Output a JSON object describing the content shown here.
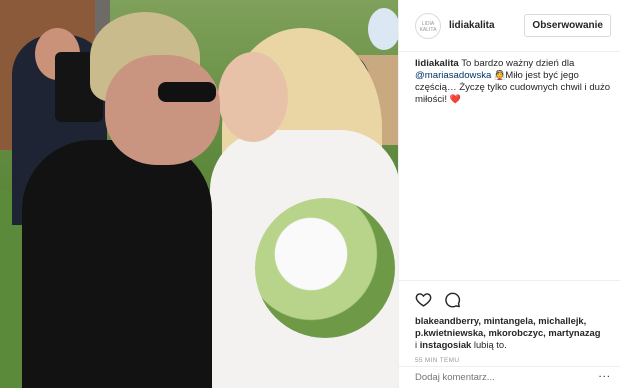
{
  "post": {
    "photo_label": "wedding photo"
  },
  "header": {
    "avatar_text": "LIDIA\nKALITA",
    "username": "lidiakalita",
    "follow_label": "Obserwowanie"
  },
  "caption": {
    "username": "lidiakalita",
    "text_1": " To bardzo ważny dzień dla ",
    "mention": "@mariasadowska",
    "emoji_1": "👰",
    "text_2": "Miło jest być jego częścią… Życzę tylko cudownych chwil i dużo miłości! ",
    "emoji_2": "❤️"
  },
  "likes": {
    "names": "blakeandberry, mintangela, michallejk, p.kwietniewska, mkorobczyc, martynazag",
    "connector": " i ",
    "last_name": "instagosiak",
    "suffix": " lubią to."
  },
  "time": "55 MIN TEMU",
  "comment": {
    "placeholder": "Dodaj komentarz...",
    "more": "···"
  },
  "icons": {
    "like": "heart-icon",
    "comment": "comment-icon",
    "more": "more-icon"
  },
  "colors": {
    "heart": "#ed4956",
    "mention": "#003569",
    "border": "#efefef",
    "muted": "#999999"
  }
}
